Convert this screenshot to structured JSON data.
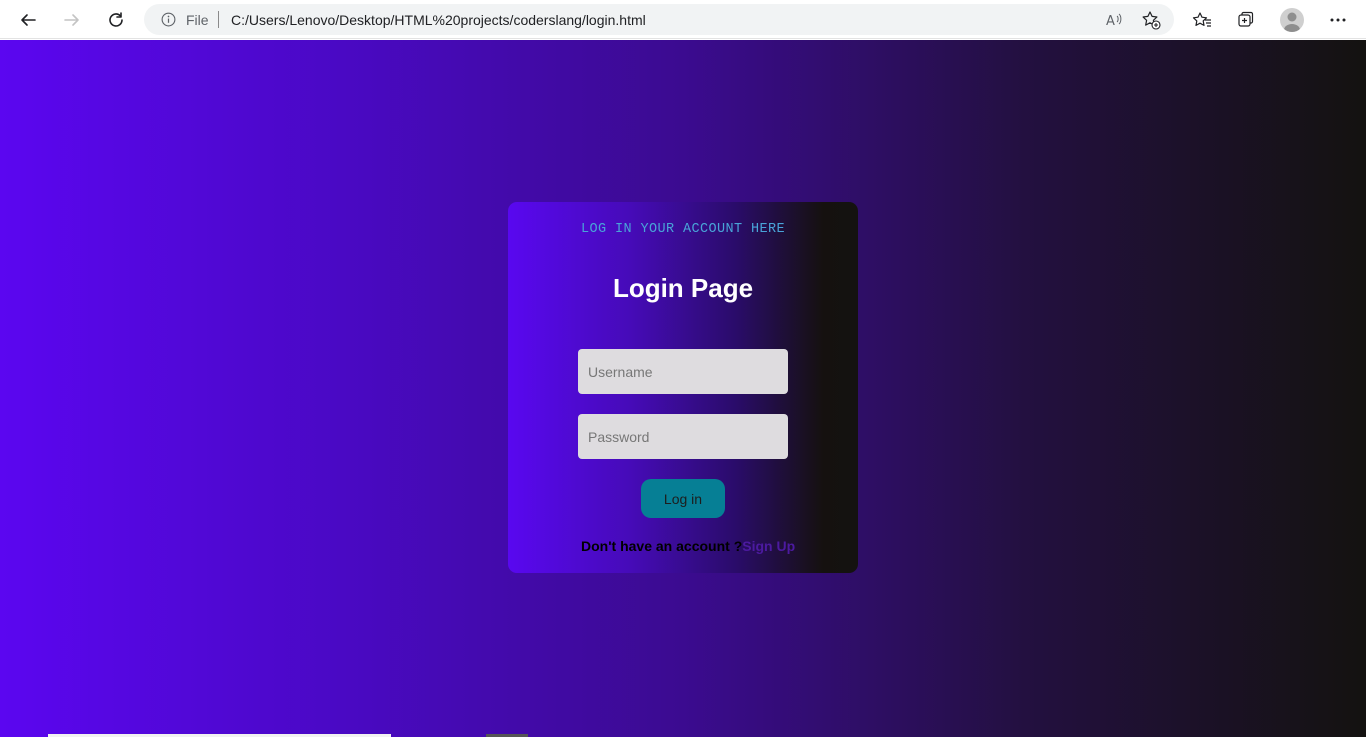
{
  "browser": {
    "file_label": "File",
    "url": "C:/Users/Lenovo/Desktop/HTML%20projects/coderslang/login.html",
    "icons": [
      "back-arrow-icon",
      "forward-arrow-icon",
      "refresh-icon",
      "info-icon",
      "read-aloud-icon",
      "add-favorite-icon",
      "favorites-icon",
      "collections-icon",
      "profile-avatar",
      "more-icon"
    ]
  },
  "login": {
    "subtitle": "LOG IN YOUR ACCOUNT HERE",
    "title": "Login Page",
    "username_placeholder": "Username",
    "password_placeholder": "Password",
    "button_label": "Log in",
    "signup_prompt": "Don't have an account ?",
    "signup_link": "Sign Up"
  },
  "colors": {
    "gradient_start": "#5b06f0",
    "gradient_end": "#141210",
    "subtitle": "#49a4d8",
    "button": "#067f95",
    "signup_link": "#4c1aa0",
    "input_bg": "#dedcdf"
  }
}
